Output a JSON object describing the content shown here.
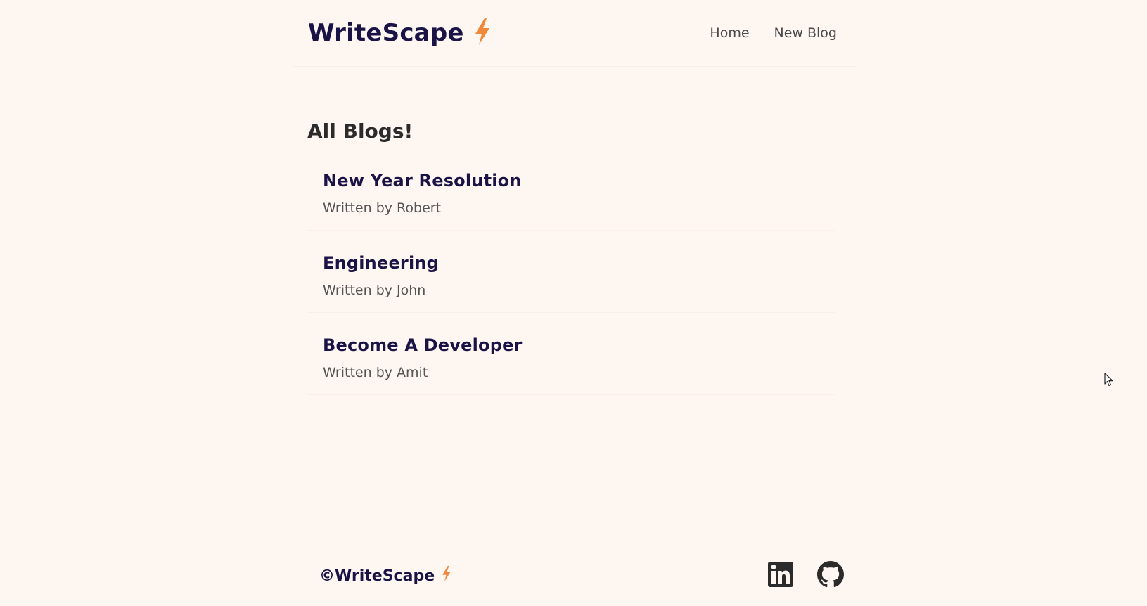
{
  "navbar": {
    "brand": "WriteScape",
    "brand_icon": "lightning-bolt-icon",
    "links": [
      {
        "label": "Home"
      },
      {
        "label": "New Blog"
      }
    ]
  },
  "main": {
    "title": "All Blogs!",
    "blogs": [
      {
        "title": "New Year Resolution",
        "author": "Written by Robert"
      },
      {
        "title": "Engineering",
        "author": "Written by John"
      },
      {
        "title": "Become A Developer",
        "author": "Written by Amit"
      }
    ]
  },
  "footer": {
    "copyright": "©WriteScape",
    "social": [
      {
        "icon": "linkedin-icon"
      },
      {
        "icon": "github-icon"
      }
    ]
  },
  "colors": {
    "background": "#fef6f1",
    "brand": "#1a1446",
    "accent": "#f1893b",
    "text": "#333333"
  }
}
